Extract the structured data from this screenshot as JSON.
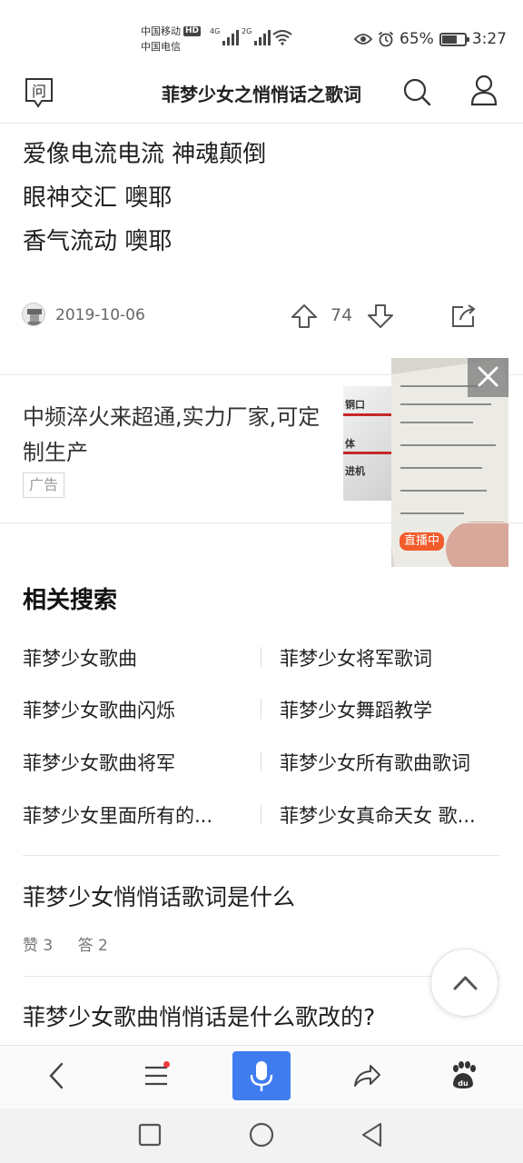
{
  "status_bar": {
    "carrier1": "中国移动",
    "carrier1_badge": "HD",
    "carrier2": "中国电信",
    "net1": "4G",
    "net2": "2G",
    "battery_percent_text": "65%",
    "battery_level": 0.65,
    "time": "3:27"
  },
  "header": {
    "ask_icon_glyph": "问",
    "title": "菲梦少女之悄悄话之歌词"
  },
  "lyrics": [
    "爱像电流电流 神魂颠倒",
    "眼神交汇 噢耶",
    "香气流动 噢耶"
  ],
  "meta": {
    "date": "2019-10-06",
    "votes": "74"
  },
  "ad": {
    "title": "中频淬火来超通,实力厂家,可定制生产",
    "badge": "广告",
    "image_labels": [
      "铜口",
      "体",
      "进机"
    ]
  },
  "live": {
    "badge": "直播中"
  },
  "related": {
    "heading": "相关搜索",
    "items": [
      "菲梦少女歌曲",
      "菲梦少女将军歌词",
      "菲梦少女歌曲闪烁",
      "菲梦少女舞蹈教学",
      "菲梦少女歌曲将军",
      "菲梦少女所有歌曲歌词",
      "菲梦少女里面所有的...",
      "菲梦少女真命天女 歌..."
    ]
  },
  "qa": [
    {
      "title": "菲梦少女悄悄话歌词是什么",
      "likes": "赞 3",
      "answers": "答 2"
    },
    {
      "title": "菲梦少女歌曲悄悄话是什么歌改的?"
    }
  ],
  "colors": {
    "accent": "#3f7cf0",
    "live_badge": "#f25b2b",
    "notify_dot": "#ee3b3b"
  }
}
